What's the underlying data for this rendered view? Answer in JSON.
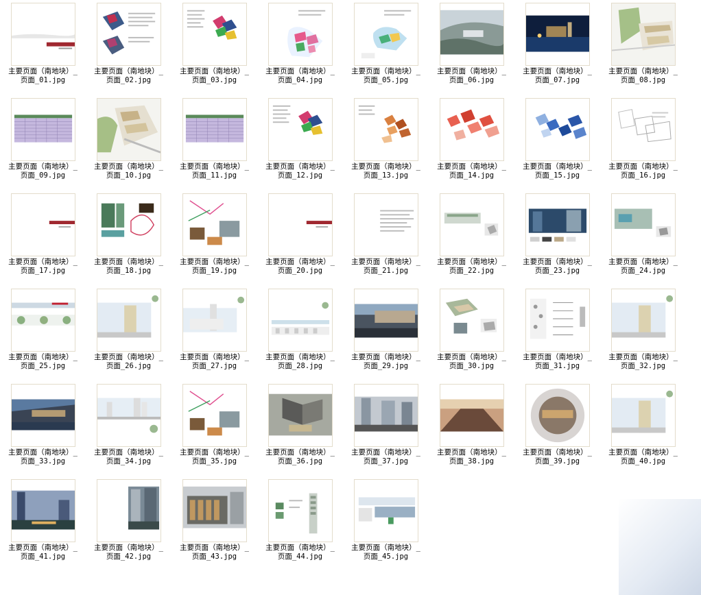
{
  "files": [
    {
      "label": "主要页面（南地块）_\n页面_01.jpg",
      "kind": "cover"
    },
    {
      "label": "主要页面（南地块）_\n页面_02.jpg",
      "kind": "text-maps"
    },
    {
      "label": "主要页面（南地块）_\n页面_03.jpg",
      "kind": "text-map-color"
    },
    {
      "label": "主要页面（南地块）_\n页面_04.jpg",
      "kind": "map-pink"
    },
    {
      "label": "主要页面（南地块）_\n页面_05.jpg",
      "kind": "map-blue"
    },
    {
      "label": "主要页面（南地块）_\n页面_06.jpg",
      "kind": "aerial"
    },
    {
      "label": "主要页面（南地块）_\n页面_07.jpg",
      "kind": "night"
    },
    {
      "label": "主要页面（南地块）_\n页面_08.jpg",
      "kind": "site-plan"
    },
    {
      "label": "主要页面（南地块）_\n页面_09.jpg",
      "kind": "table"
    },
    {
      "label": "主要页面（南地块）_\n页面_10.jpg",
      "kind": "site-plan-large"
    },
    {
      "label": "主要页面（南地块）_\n页面_11.jpg",
      "kind": "table"
    },
    {
      "label": "主要页面（南地块）_\n页面_12.jpg",
      "kind": "text-map-color"
    },
    {
      "label": "主要页面（南地块）_\n页面_13.jpg",
      "kind": "map-orange"
    },
    {
      "label": "主要页面（南地块）_\n页面_14.jpg",
      "kind": "map-red"
    },
    {
      "label": "主要页面（南地块）_\n页面_15.jpg",
      "kind": "map-darkblue"
    },
    {
      "label": "主要页面（南地块）_\n页面_16.jpg",
      "kind": "map-gray"
    },
    {
      "label": "主要页面（南地块）_\n页面_17.jpg",
      "kind": "section-cover"
    },
    {
      "label": "主要页面（南地块）_\n页面_18.jpg",
      "kind": "photos-diagram"
    },
    {
      "label": "主要页面（南地块）_\n页面_19.jpg",
      "kind": "collage"
    },
    {
      "label": "主要页面（南地块）_\n页面_20.jpg",
      "kind": "section-cover"
    },
    {
      "label": "主要页面（南地块）_\n页面_21.jpg",
      "kind": "text-page"
    },
    {
      "label": "主要页面（南地块）_\n页面_22.jpg",
      "kind": "elevation-small"
    },
    {
      "label": "主要页面（南地块）_\n页面_23.jpg",
      "kind": "material"
    },
    {
      "label": "主要页面（南地块）_\n页面_24.jpg",
      "kind": "render-small"
    },
    {
      "label": "主要页面（南地块）_\n页面_25.jpg",
      "kind": "strip"
    },
    {
      "label": "主要页面（南地块）_\n页面_26.jpg",
      "kind": "elev-tower"
    },
    {
      "label": "主要页面（南地块）_\n页面_27.jpg",
      "kind": "elev-low"
    },
    {
      "label": "主要页面（南地块）_\n页面_28.jpg",
      "kind": "elev-long"
    },
    {
      "label": "主要页面（南地块）_\n页面_29.jpg",
      "kind": "render-street"
    },
    {
      "label": "主要页面（南地块）_\n页面_30.jpg",
      "kind": "render-axo"
    },
    {
      "label": "主要页面（南地块）_\n页面_31.jpg",
      "kind": "sections"
    },
    {
      "label": "主要页面（南地块）_\n页面_32.jpg",
      "kind": "elev-tower"
    },
    {
      "label": "主要页面（南地块）_\n页面_33.jpg",
      "kind": "render-dusk"
    },
    {
      "label": "主要页面（南地块）_\n页面_34.jpg",
      "kind": "elev-skyline"
    },
    {
      "label": "主要页面（南地块）_\n页面_35.jpg",
      "kind": "collage"
    },
    {
      "label": "主要页面（南地块）_\n页面_36.jpg",
      "kind": "render-aerial"
    },
    {
      "label": "主要页面（南地块）_\n页面_37.jpg",
      "kind": "render-gray"
    },
    {
      "label": "主要页面（南地块）_\n页面_38.jpg",
      "kind": "render-interior"
    },
    {
      "label": "主要页面（南地块）_\n页面_39.jpg",
      "kind": "circle"
    },
    {
      "label": "主要页面（南地块）_\n页面_40.jpg",
      "kind": "elev-tower"
    },
    {
      "label": "主要页面（南地块）_\n页面_41.jpg",
      "kind": "render-blue"
    },
    {
      "label": "主要页面（南地块）_\n页面_42.jpg",
      "kind": "render-vertical"
    },
    {
      "label": "主要页面（南地块）_\n页面_43.jpg",
      "kind": "render-facade"
    },
    {
      "label": "主要页面（南地块）_\n页面_44.jpg",
      "kind": "plans"
    },
    {
      "label": "主要页面（南地块）_\n页面_45.jpg",
      "kind": "board"
    }
  ]
}
